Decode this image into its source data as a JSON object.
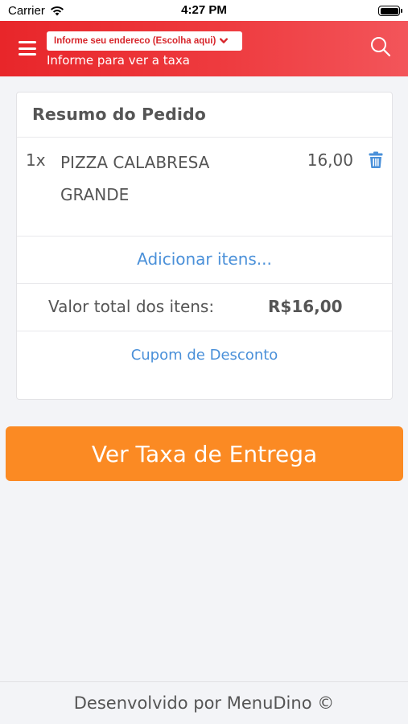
{
  "status_bar": {
    "carrier": "Carrier",
    "time": "4:27 PM"
  },
  "header": {
    "address_select": "Informe seu endereco (Escolha aqui)",
    "subtitle": "Informe para ver a taxa",
    "icons": [
      "menu-icon",
      "chevron-down-icon",
      "search-icon"
    ]
  },
  "order": {
    "title": "Resumo do Pedido",
    "items": [
      {
        "qty": "1x",
        "name": "PIZZA CALABRESA GRANDE",
        "price": "16,00"
      }
    ],
    "add_items_label": "Adicionar itens...",
    "total_label": "Valor total dos itens:",
    "total_value": "R$16,00",
    "coupon_label": "Cupom de Desconto"
  },
  "cta": {
    "label": "Ver Taxa de Entrega"
  },
  "footer": {
    "text": "Desenvolvido por MenuDino ©"
  },
  "colors": {
    "header": "#e8262a",
    "cta": "#fb8a23",
    "link": "#4a90d9",
    "background": "#f3f4f7"
  }
}
